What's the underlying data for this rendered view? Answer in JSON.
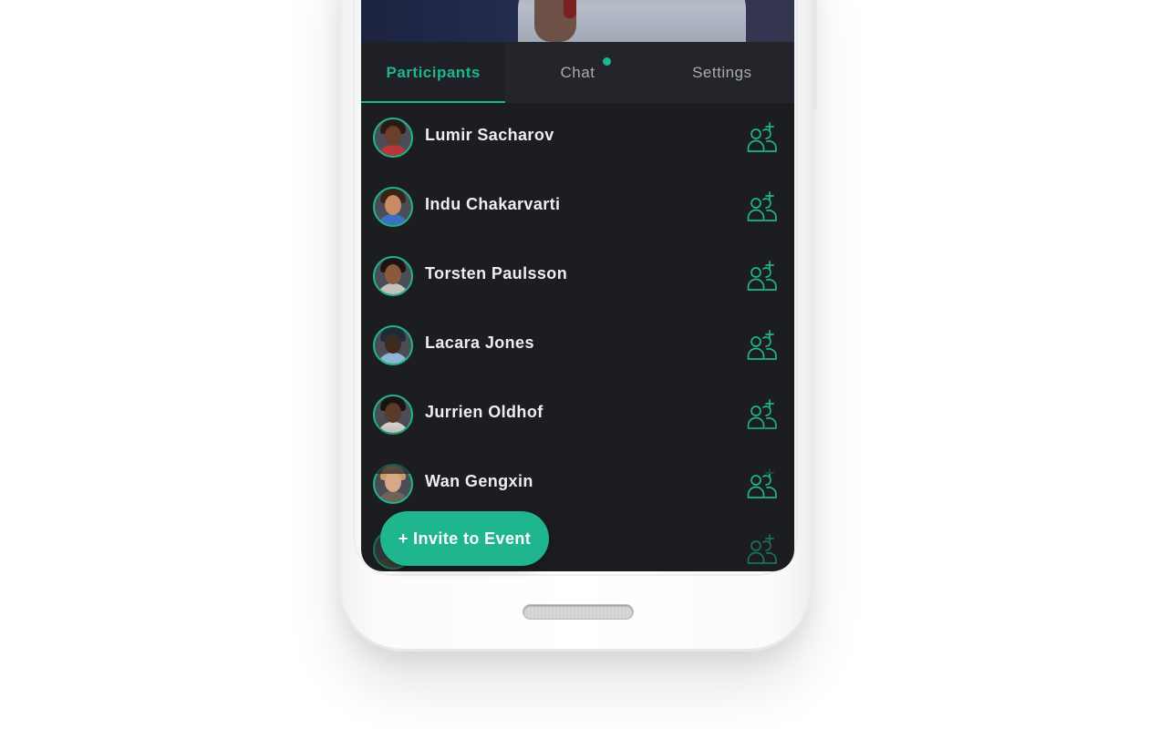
{
  "tabs": [
    {
      "label": "Participants",
      "active": true
    },
    {
      "label": "Chat",
      "active": false,
      "has_notification_dot": true
    },
    {
      "label": "Settings",
      "active": false
    }
  ],
  "participants": [
    {
      "name": "Lumir Sacharov",
      "avatar": {
        "skin": "#6a3f2e",
        "hair": "#2b1a14",
        "shirt": "#b8353a"
      }
    },
    {
      "name": "Indu Chakarvarti",
      "avatar": {
        "skin": "#c98b63",
        "hair": "#3a2418",
        "shirt": "#3c70c0"
      }
    },
    {
      "name": "Torsten Paulsson",
      "avatar": {
        "skin": "#8a5a3e",
        "hair": "#1d1410",
        "shirt": "#c5c1bc"
      }
    },
    {
      "name": "Lacara Jones",
      "avatar": {
        "skin": "#3d2a20",
        "hair": "#1f2a3a",
        "shirt": "#8fb6d2"
      }
    },
    {
      "name": "Jurrien Oldhof",
      "avatar": {
        "skin": "#5a3a28",
        "hair": "#1a1410",
        "shirt": "#e0ddd8"
      }
    },
    {
      "name": "Wan Gengxin",
      "avatar": {
        "skin": "#d8a889",
        "hair": "#c99d6a",
        "shirt": "#6f6256"
      }
    },
    {
      "name": "",
      "avatar": {
        "skin": "#7b6a55",
        "hair": "#3b3a2c",
        "shirt": "#4f5a46"
      }
    }
  ],
  "fab": {
    "label": "+ Invite to Event"
  },
  "icons": {
    "add_participant": "add-user-icon"
  },
  "colors": {
    "accent": "#1fb58e",
    "background": "#1c1d21",
    "tab_bar": "#23252a",
    "text": "#eceef1",
    "muted": "#a8abb1"
  }
}
